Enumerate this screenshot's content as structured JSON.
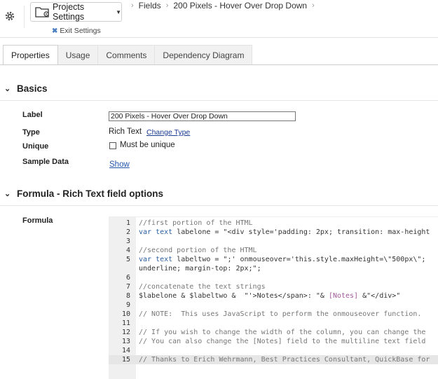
{
  "header": {
    "projects_button": "Projects Settings",
    "exit_settings": "Exit Settings",
    "breadcrumbs": [
      "Fields",
      "200 Pixels - Hover Over Drop Down"
    ]
  },
  "tabs": [
    "Properties",
    "Usage",
    "Comments",
    "Dependency Diagram"
  ],
  "basics": {
    "title": "Basics",
    "label_label": "Label",
    "label_value": "200 Pixels - Hover Over Drop Down",
    "type_label": "Type",
    "type_value": "Rich Text",
    "change_type": "Change Type",
    "unique_label": "Unique",
    "unique_option": "Must be unique",
    "sample_label": "Sample Data",
    "sample_link": "Show"
  },
  "formula_section": {
    "title": "Formula - Rich Text field options",
    "formula_label": "Formula"
  },
  "code_lines": [
    {
      "n": "1",
      "text": "//first portion of the HTML"
    },
    {
      "n": "2",
      "text": "var text labelone = \"<div style='padding: 2px; transition: max-height"
    },
    {
      "n": "3",
      "text": ""
    },
    {
      "n": "4",
      "text": "//second portion of the HTML"
    },
    {
      "n": "5",
      "text": "var text labeltwo = \";' onmouseover='this.style.maxHeight=\\\"500px\\\";"
    },
    {
      "n": "",
      "text": "underline; margin-top: 2px;\";"
    },
    {
      "n": "6",
      "text": ""
    },
    {
      "n": "7",
      "text": "//concatenate the text strings"
    },
    {
      "n": "8",
      "text": "$labelone & $labeltwo &  \"'>Notes</span>: \"& [Notes] &\"</div>\""
    },
    {
      "n": "9",
      "text": ""
    },
    {
      "n": "10",
      "text": "// NOTE:  This uses JavaScript to perform the onmouseover function."
    },
    {
      "n": "11",
      "text": ""
    },
    {
      "n": "12",
      "text": "// If you wish to change the width of the column, you can change the"
    },
    {
      "n": "13",
      "text": "// You can also change the [Notes] field to the multiline text field"
    },
    {
      "n": "14",
      "text": ""
    },
    {
      "n": "15",
      "text": "// Thanks to Erich Wehrmann, Best Practices Consultant, QuickBase for"
    }
  ]
}
